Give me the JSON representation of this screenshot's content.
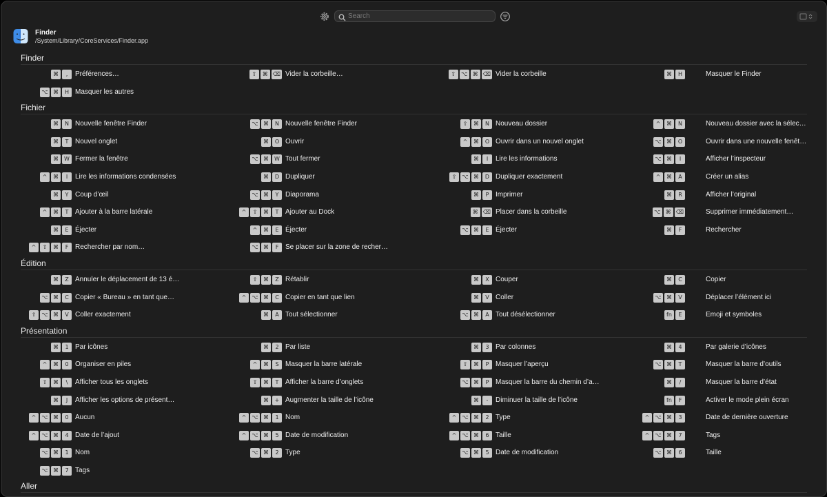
{
  "toolbar": {
    "search_placeholder": "Search",
    "icons": [
      "gear-icon",
      "search-icon",
      "filter-icon",
      "view-toggle-icon"
    ]
  },
  "app": {
    "name": "Finder",
    "path": "/System/Library/CoreServices/Finder.app",
    "icon": "finder-app-icon"
  },
  "sections": [
    {
      "title": "Finder",
      "items": [
        {
          "keys": [
            "⌘",
            ","
          ],
          "label": "Préférences…"
        },
        {
          "keys": [
            "⇧",
            "⌘",
            "⌫"
          ],
          "label": "Vider la corbeille…"
        },
        {
          "keys": [
            "⇧",
            "⌥",
            "⌘",
            "⌫"
          ],
          "label": "Vider la corbeille"
        },
        {
          "keys": [
            "⌘",
            "H"
          ],
          "label": "Masquer le Finder"
        },
        {
          "keys": [
            "⌥",
            "⌘",
            "H"
          ],
          "label": "Masquer les autres"
        }
      ]
    },
    {
      "title": "Fichier",
      "items": [
        {
          "keys": [
            "⌘",
            "N"
          ],
          "label": "Nouvelle fenêtre Finder"
        },
        {
          "keys": [
            "⌥",
            "⌘",
            "N"
          ],
          "label": "Nouvelle fenêtre Finder"
        },
        {
          "keys": [
            "⇧",
            "⌘",
            "N"
          ],
          "label": "Nouveau dossier"
        },
        {
          "keys": [
            "^",
            "⌘",
            "N"
          ],
          "label": "Nouveau dossier avec la sélecti…"
        },
        {
          "keys": [
            "⌘",
            "T"
          ],
          "label": "Nouvel onglet"
        },
        {
          "keys": [
            "⌘",
            "O"
          ],
          "label": "Ouvrir"
        },
        {
          "keys": [
            "^",
            "⌘",
            "O"
          ],
          "label": "Ouvrir dans un nouvel onglet"
        },
        {
          "keys": [
            "⌥",
            "⌘",
            "O"
          ],
          "label": "Ouvrir dans une nouvelle fenêtr…"
        },
        {
          "keys": [
            "⌘",
            "W"
          ],
          "label": "Fermer la fenêtre"
        },
        {
          "keys": [
            "⌥",
            "⌘",
            "W"
          ],
          "label": "Tout fermer"
        },
        {
          "keys": [
            "⌘",
            "I"
          ],
          "label": "Lire les informations"
        },
        {
          "keys": [
            "⌥",
            "⌘",
            "I"
          ],
          "label": "Afficher l’inspecteur"
        },
        {
          "keys": [
            "^",
            "⌘",
            "I"
          ],
          "label": "Lire les informations condensées"
        },
        {
          "keys": [
            "⌘",
            "D"
          ],
          "label": "Dupliquer"
        },
        {
          "keys": [
            "⇧",
            "⌥",
            "⌘",
            "D"
          ],
          "label": "Dupliquer exactement"
        },
        {
          "keys": [
            "^",
            "⌘",
            "A"
          ],
          "label": "Créer un alias"
        },
        {
          "keys": [
            "⌘",
            "Y"
          ],
          "label": "Coup d’œil"
        },
        {
          "keys": [
            "⌥",
            "⌘",
            "Y"
          ],
          "label": "Diaporama"
        },
        {
          "keys": [
            "⌘",
            "P"
          ],
          "label": "Imprimer"
        },
        {
          "keys": [
            "⌘",
            "R"
          ],
          "label": "Afficher l’original"
        },
        {
          "keys": [
            "^",
            "⌘",
            "T"
          ],
          "label": "Ajouter à la barre latérale"
        },
        {
          "keys": [
            "^",
            "⇧",
            "⌘",
            "T"
          ],
          "label": "Ajouter au Dock"
        },
        {
          "keys": [
            "⌘",
            "⌫"
          ],
          "label": "Placer dans la corbeille"
        },
        {
          "keys": [
            "⌥",
            "⌘",
            "⌫"
          ],
          "label": "Supprimer immédiatement…"
        },
        {
          "keys": [
            "⌘",
            "E"
          ],
          "label": "Éjecter"
        },
        {
          "keys": [
            "^",
            "⌘",
            "E"
          ],
          "label": "Éjecter"
        },
        {
          "keys": [
            "⌥",
            "⌘",
            "E"
          ],
          "label": "Éjecter"
        },
        {
          "keys": [
            "⌘",
            "F"
          ],
          "label": "Rechercher"
        },
        {
          "keys": [
            "^",
            "⇧",
            "⌘",
            "F"
          ],
          "label": "Rechercher par nom…"
        },
        {
          "keys": [
            "⌥",
            "⌘",
            "F"
          ],
          "label": "Se placer sur la zone de recher…"
        }
      ]
    },
    {
      "title": "Édition",
      "items": [
        {
          "keys": [
            "⌘",
            "Z"
          ],
          "label": "Annuler le déplacement de 13 é…"
        },
        {
          "keys": [
            "⇧",
            "⌘",
            "Z"
          ],
          "label": "Rétablir"
        },
        {
          "keys": [
            "⌘",
            "X"
          ],
          "label": "Couper"
        },
        {
          "keys": [
            "⌘",
            "C"
          ],
          "label": "Copier"
        },
        {
          "keys": [
            "⌥",
            "⌘",
            "C"
          ],
          "label": "Copier « Bureau » en tant que…"
        },
        {
          "keys": [
            "^",
            "⌥",
            "⌘",
            "C"
          ],
          "label": "Copier en tant que lien"
        },
        {
          "keys": [
            "⌘",
            "V"
          ],
          "label": "Coller"
        },
        {
          "keys": [
            "⌥",
            "⌘",
            "V"
          ],
          "label": "Déplacer l’élément ici"
        },
        {
          "keys": [
            "⇧",
            "⌥",
            "⌘",
            "V"
          ],
          "label": "Coller exactement"
        },
        {
          "keys": [
            "⌘",
            "A"
          ],
          "label": "Tout sélectionner"
        },
        {
          "keys": [
            "⌥",
            "⌘",
            "A"
          ],
          "label": "Tout désélectionner"
        },
        {
          "keys": [
            "fn",
            "E"
          ],
          "label": "Emoji et symboles"
        }
      ]
    },
    {
      "title": "Présentation",
      "items": [
        {
          "keys": [
            "⌘",
            "1"
          ],
          "label": "Par icônes"
        },
        {
          "keys": [
            "⌘",
            "2"
          ],
          "label": "Par liste"
        },
        {
          "keys": [
            "⌘",
            "3"
          ],
          "label": "Par colonnes"
        },
        {
          "keys": [
            "⌘",
            "4"
          ],
          "label": "Par galerie d’icônes"
        },
        {
          "keys": [
            "^",
            "⌘",
            "0"
          ],
          "label": "Organiser en piles"
        },
        {
          "keys": [
            "^",
            "⌘",
            "S"
          ],
          "label": "Masquer la barre latérale"
        },
        {
          "keys": [
            "⇧",
            "⌘",
            "P"
          ],
          "label": "Masquer l’aperçu"
        },
        {
          "keys": [
            "⌥",
            "⌘",
            "T"
          ],
          "label": "Masquer la barre d’outils"
        },
        {
          "keys": [
            "⇧",
            "⌘",
            "\\"
          ],
          "label": "Afficher tous les onglets"
        },
        {
          "keys": [
            "⇧",
            "⌘",
            "T"
          ],
          "label": "Afficher la barre d’onglets"
        },
        {
          "keys": [
            "⌥",
            "⌘",
            "P"
          ],
          "label": "Masquer la barre du chemin d’a…"
        },
        {
          "keys": [
            "⌘",
            "/"
          ],
          "label": "Masquer la barre d’état"
        },
        {
          "keys": [
            "⌘",
            "J"
          ],
          "label": "Afficher les options de présent…"
        },
        {
          "keys": [
            "⌘",
            "+"
          ],
          "label": "Augmenter la taille de l’icône"
        },
        {
          "keys": [
            "⌘",
            "-"
          ],
          "label": "Diminuer la taille de l’icône"
        },
        {
          "keys": [
            "fn",
            "F"
          ],
          "label": "Activer le mode plein écran"
        },
        {
          "keys": [
            "^",
            "⌥",
            "⌘",
            "0"
          ],
          "label": "Aucun"
        },
        {
          "keys": [
            "^",
            "⌥",
            "⌘",
            "1"
          ],
          "label": "Nom"
        },
        {
          "keys": [
            "^",
            "⌥",
            "⌘",
            "2"
          ],
          "label": "Type"
        },
        {
          "keys": [
            "^",
            "⌥",
            "⌘",
            "3"
          ],
          "label": "Date de dernière ouverture"
        },
        {
          "keys": [
            "^",
            "⌥",
            "⌘",
            "4"
          ],
          "label": "Date de l’ajout"
        },
        {
          "keys": [
            "^",
            "⌥",
            "⌘",
            "5"
          ],
          "label": "Date de modification"
        },
        {
          "keys": [
            "^",
            "⌥",
            "⌘",
            "6"
          ],
          "label": "Taille"
        },
        {
          "keys": [
            "^",
            "⌥",
            "⌘",
            "7"
          ],
          "label": "Tags"
        },
        {
          "keys": [
            "⌥",
            "⌘",
            "1"
          ],
          "label": "Nom"
        },
        {
          "keys": [
            "⌥",
            "⌘",
            "2"
          ],
          "label": "Type"
        },
        {
          "keys": [
            "⌥",
            "⌘",
            "5"
          ],
          "label": "Date de modification"
        },
        {
          "keys": [
            "⌥",
            "⌘",
            "6"
          ],
          "label": "Taille"
        },
        {
          "keys": [
            "⌥",
            "⌘",
            "7"
          ],
          "label": "Tags"
        }
      ]
    },
    {
      "title": "Aller",
      "items": []
    }
  ]
}
